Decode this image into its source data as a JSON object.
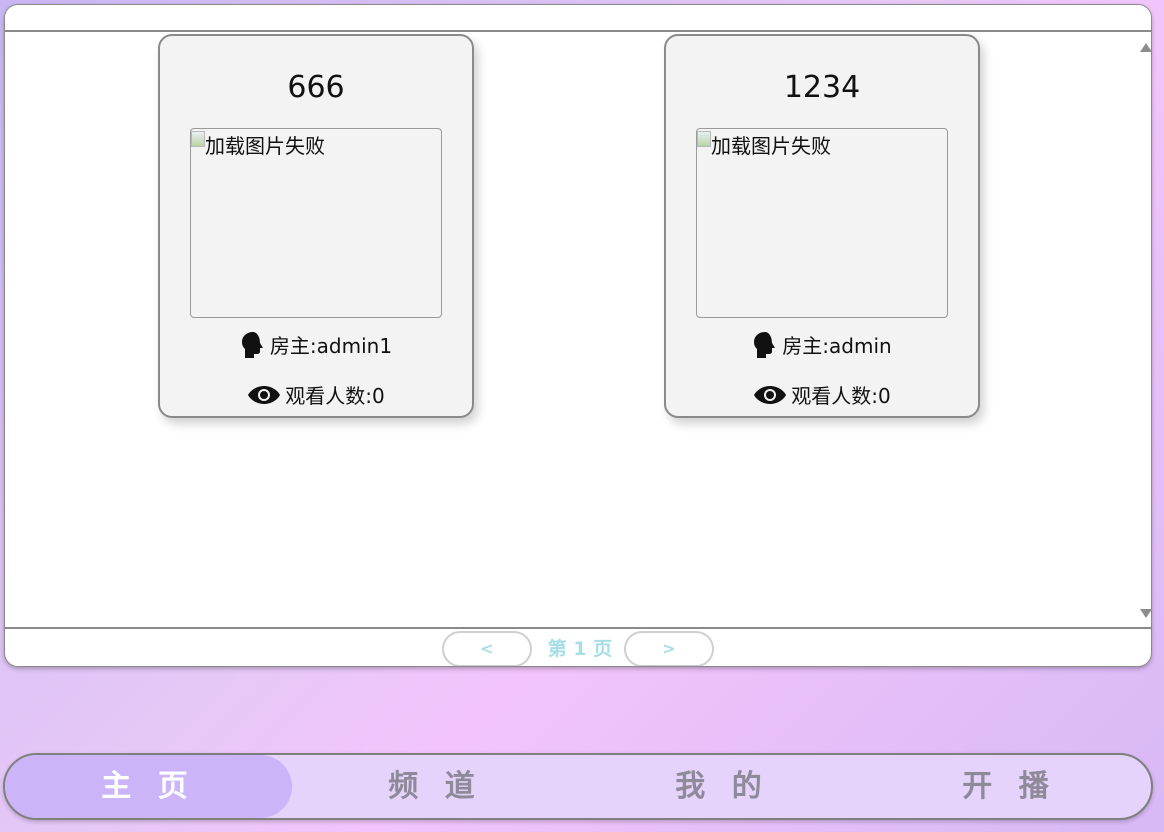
{
  "rooms": [
    {
      "title": "666",
      "image_alt": "加载图片失败",
      "owner_label": "房主:admin1",
      "viewers_label": "观看人数:0"
    },
    {
      "title": "1234",
      "image_alt": "加载图片失败",
      "owner_label": "房主:admin",
      "viewers_label": "观看人数:0"
    }
  ],
  "pager": {
    "prev_label": "<",
    "page_label": "第 1 页",
    "next_label": ">"
  },
  "nav": {
    "items": [
      {
        "label": "主 页",
        "active": true
      },
      {
        "label": "频 道",
        "active": false
      },
      {
        "label": "我 的",
        "active": false
      },
      {
        "label": "开 播",
        "active": false
      }
    ]
  },
  "icons": {
    "owner": "person-head-icon",
    "viewers": "eye-icon",
    "broken_image": "broken-image-icon",
    "scroll_up": "triangle-up-icon",
    "scroll_down": "triangle-down-icon"
  },
  "colors": {
    "accent_nav_active": "#cbb5f8",
    "nav_background": "#e5d3fb",
    "pager_text": "#a6dde6",
    "card_background": "#f3f3f3"
  }
}
